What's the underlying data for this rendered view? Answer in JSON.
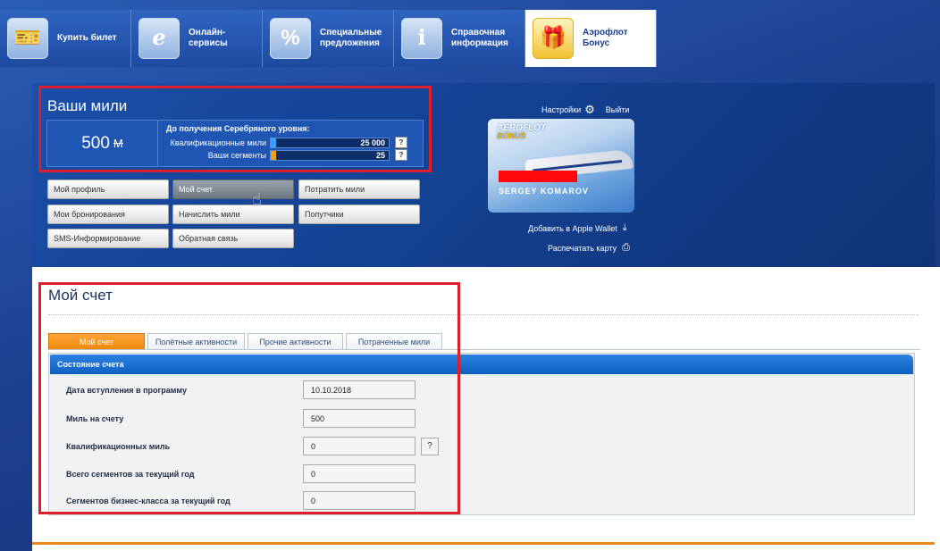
{
  "nav": {
    "items": [
      {
        "label": "Купить билет",
        "icon": "tickets-icon"
      },
      {
        "label": "Онлайн-\nсервисы",
        "icon": "browser-icon"
      },
      {
        "label": "Специальные\nпредложения",
        "icon": "percent-icon"
      },
      {
        "label": "Справочная\nинформация",
        "icon": "info-icon"
      },
      {
        "label": "Аэрофлот Бонус",
        "icon": "gift-icon"
      }
    ]
  },
  "miles": {
    "title": "Ваши мили",
    "total": "500",
    "unit": "М",
    "progress_title": "До получения Серебряного уровня:",
    "qual_label": "Квалификационные мили",
    "qual_value": "25 000",
    "seg_label": "Ваши сегменты",
    "seg_value": "25",
    "help": "?"
  },
  "menu": {
    "profile": "Мой профиль",
    "account": "Мой счет",
    "spend": "Потратить мили",
    "bookings": "Мои бронирования",
    "accrue": "Начислить мили",
    "companions": "Попутчики",
    "sms": "SMS-Информирование",
    "feedback": "Обратная связь"
  },
  "header_links": {
    "settings": "Настройки",
    "logout": "Выйти",
    "wallet": "Добавить в Apple Wallet",
    "print": "Распечатать карту"
  },
  "card": {
    "logo_top": "AEROFLOT",
    "logo_bottom": "BONUS",
    "holder": "SERGEY KOMAROV"
  },
  "page": {
    "title": "Мой счет",
    "tabs": [
      "Мой счет",
      "Полётные активности",
      "Прочие активности",
      "Потраченные мили"
    ],
    "section_title": "Состояние счета",
    "fields": [
      {
        "label": "Дата вступления в программу",
        "value": "10.10.2018"
      },
      {
        "label": "Миль на счету",
        "value": "500"
      },
      {
        "label": "Квалификационных миль",
        "value": "0"
      },
      {
        "label": "Всего сегментов за текущий год",
        "value": "0"
      },
      {
        "label": "Сегментов бизнес-класса за текущий год",
        "value": "0"
      }
    ],
    "help": "?"
  },
  "colors": {
    "accent_orange": "#f08a0a",
    "brand_blue": "#1b3f8c",
    "highlight_red": "#dd1e2b"
  }
}
